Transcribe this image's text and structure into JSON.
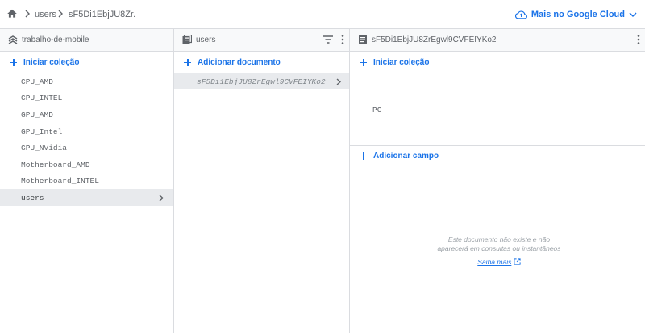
{
  "breadcrumb": {
    "collection": "users",
    "document": "sF5Di1EbjJU8Zr."
  },
  "header_link": {
    "label": "Mais no Google Cloud"
  },
  "panel_root": {
    "title": "trabalho-de-mobile",
    "start_collection": "Iniciar coleção",
    "collections": [
      "CPU_AMD",
      "CPU_INTEL",
      "GPU_AMD",
      "GPU_Intel",
      "GPU_NVidia",
      "Motherboard_AMD",
      "Motherboard_INTEL",
      "users"
    ],
    "selected_index": 7
  },
  "panel_collection": {
    "title": "users",
    "add_document": "Adicionar documento",
    "documents": [
      "sF5Di1EbjJU8ZrEgwl9CVFEIYKo2"
    ]
  },
  "panel_document": {
    "title": "sF5Di1EbjJU8ZrEgwl9CVFEIYKo2",
    "start_collection": "Iniciar coleção",
    "subcollections": [
      "PC"
    ],
    "add_field": "Adicionar campo",
    "empty_line1": "Este documento não existe e não",
    "empty_line2": "aparecerá em consultas ou instantâneos",
    "learn_more": "Saiba mais"
  },
  "colors": {
    "accent": "#1a73e8",
    "selected_bg": "#e8eaed",
    "border": "#dadce0",
    "header_bg": "#f8f9fa"
  }
}
